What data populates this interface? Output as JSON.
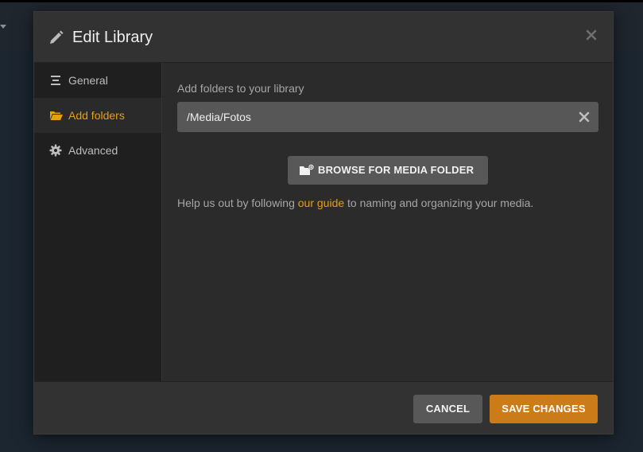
{
  "dialog": {
    "title": "Edit Library",
    "close_label": "×"
  },
  "sidebar": {
    "items": [
      {
        "label": "General",
        "icon": "list-icon",
        "active": false
      },
      {
        "label": "Add folders",
        "icon": "folder-open-icon",
        "active": true
      },
      {
        "label": "Advanced",
        "icon": "gear-icon",
        "active": false
      }
    ]
  },
  "folders": {
    "label": "Add folders to your library",
    "path_value": "/Media/Fotos",
    "browse_label": "BROWSE FOR MEDIA FOLDER",
    "help_prefix": "Help us out by following ",
    "help_link": "our guide",
    "help_suffix": " to naming and organizing your media."
  },
  "footer": {
    "cancel_label": "CANCEL",
    "save_label": "SAVE CHANGES"
  },
  "colors": {
    "accent": "#e5a00d",
    "save_button": "#cc7b19",
    "modal_bg": "#282828"
  }
}
